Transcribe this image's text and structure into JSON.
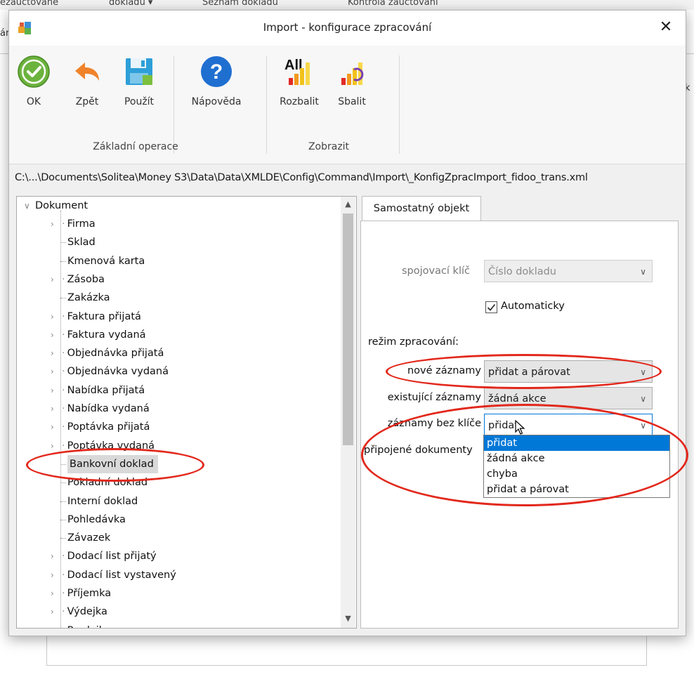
{
  "background": {
    "tabs": [
      "ezaúčtované",
      "dokladu ▾",
      "Seznam dokladů",
      "Kontrola zaúčtování"
    ],
    "left_fragment": "ár",
    "right_fragment": "k"
  },
  "dialog": {
    "title": "Import - konfigurace zpracování",
    "close_label": "✕"
  },
  "ribbon": {
    "buttons": [
      {
        "label": "OK",
        "icon": "ok-icon"
      },
      {
        "label": "Zpět",
        "icon": "back-arrow-icon"
      },
      {
        "label": "Použít",
        "icon": "save-icon"
      },
      {
        "label": "Nápověda",
        "icon": "help-icon"
      },
      {
        "label": "Rozbalit",
        "icon": "expand-all-icon",
        "badge": "All"
      },
      {
        "label": "Sbalit",
        "icon": "collapse-icon"
      }
    ],
    "groups": [
      "Základní operace",
      "Zobrazit"
    ]
  },
  "config_path": "C:\\...\\Documents\\Solitea\\Money S3\\Data\\Data\\XMLDE\\Config\\Command\\Import\\_KonfigZpracImport_fidoo_trans.xml",
  "tree": {
    "root": "Dokument",
    "items": [
      "Firma",
      "Sklad",
      "Kmenová karta",
      "Zásoba",
      "Zakázka",
      "Faktura přijatá",
      "Faktura vydaná",
      "Objednávka přijatá",
      "Objednávka vydaná",
      "Nabídka přijatá",
      "Nabídka vydaná",
      "Poptávka přijatá",
      "Poptávka vydaná",
      "Bankovní doklad",
      "Pokladní doklad",
      "Interní doklad",
      "Pohledávka",
      "Závazek",
      "Dodací list přijatý",
      "Dodací list vystavený",
      "Příjemka",
      "Výdejka",
      "Prodejka"
    ],
    "expandable": [
      true,
      false,
      false,
      true,
      false,
      true,
      true,
      true,
      true,
      true,
      true,
      true,
      true,
      false,
      false,
      false,
      false,
      false,
      true,
      true,
      true,
      true,
      true
    ],
    "selected": "Bankovní doklad"
  },
  "panel": {
    "tab_label": "Samostatný objekt",
    "key_label": "spojovací klíč",
    "key_value": "Číslo dokladu",
    "auto_label": "Automaticky",
    "auto_checked": true,
    "mode_heading": "režim zpracování:",
    "new_label": "nové záznamy",
    "new_value": "přidat a párovat",
    "existing_label": "existující záznamy",
    "existing_value": "žádná akce",
    "nokey_label": "záznamy bez klíče",
    "nokey_value": "přidat",
    "attached_label": "připojené dokumenty",
    "options": [
      "přidat",
      "žádná akce",
      "chyba",
      "přidat a párovat"
    ],
    "highlighted_option": "přidat"
  },
  "colors": {
    "annotation": "#e2281c",
    "highlight": "#0078d7",
    "ok_green": "#6cb33e",
    "back_orange": "#f0832a",
    "help_blue": "#1f6fd1"
  }
}
